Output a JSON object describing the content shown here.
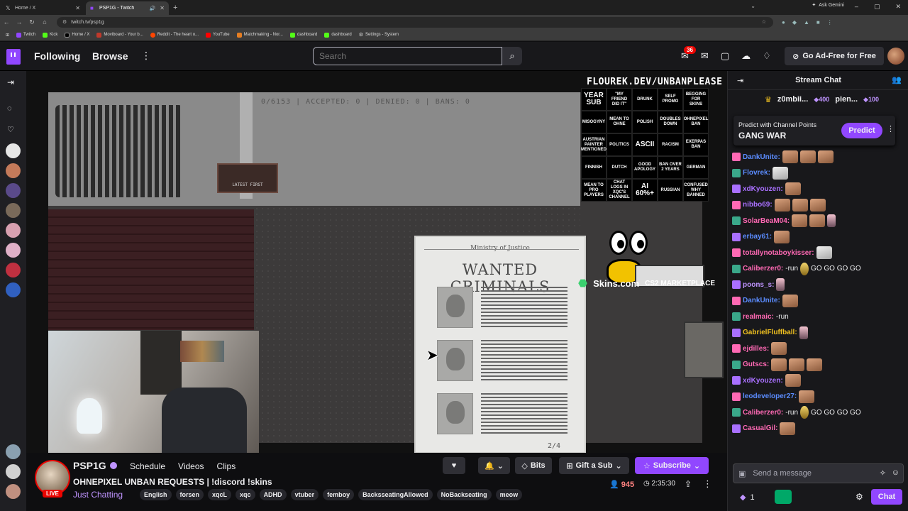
{
  "browser": {
    "tabs": [
      {
        "title": "Home / X",
        "active": false,
        "favicon": "x-icon"
      },
      {
        "title": "PSP1G - Twitch",
        "active": true,
        "favicon": "twitch-icon"
      }
    ],
    "url": "twitch.tv/psp1g",
    "ask_gemini": "Ask Gemini",
    "bookmarks": [
      "Twitch",
      "Kick",
      "Home / X",
      "Moviboard - Your b...",
      "Reddit - The heart o...",
      "YouTube",
      "Matchmaking - Nor...",
      "dashboard",
      "dashboard",
      "Settings - System"
    ]
  },
  "nav": {
    "following": "Following",
    "browse": "Browse",
    "search_placeholder": "Search",
    "notifications_count": "36",
    "ad_free": "Go Ad-Free for Free"
  },
  "stream": {
    "counter": "0/6153 | ACCEPTED: 0 | DENIED: 0 | BANS: 0",
    "latest_first": "LATEST FIRST",
    "doc_ministry": "Ministry of Justice",
    "doc_title": "WANTED CRIMINALS",
    "doc_page": "2/4",
    "overlay_url": "FLOUREK.DEV/UNBANPLEASE",
    "bingo": [
      "YEAR SUB",
      "\"MY FRIEND DID IT\"",
      "DRUNK",
      "SELF PROMO",
      "BEGGING FOR SKINS",
      "MISOGYNY",
      "MEAN TO OHNE",
      "POLISH",
      "DOUBLES DOWN",
      "OHNEPIXEL BAN",
      "AUSTRIAN PAINTER MENTIONED",
      "POLITICS",
      "ASCII",
      "RACISM",
      "EXERPAS BAN",
      "FINNISH",
      "DUTCH",
      "GOOD APOLOGY",
      "BAN OVER 2 YEARS",
      "GERMAN",
      "MEAN TO PRO PLAYERS",
      "CHAT LOGS IN XQC'S CHANNEL",
      "AI 60%+",
      "RUSSIAN",
      "CONFUSED WHY BANNED"
    ],
    "skins_brand": "Skins.com",
    "skins_tagline": "CS2 MARKETPLACE"
  },
  "channel": {
    "name": "PSP1G",
    "tabs": [
      "Schedule",
      "Videos",
      "Clips"
    ],
    "title": "OHNEPIXEL UNBAN REQUESTS | !discord !skins",
    "category": "Just Chatting",
    "tags": [
      "English",
      "forsen",
      "xqcL",
      "xqc",
      "ADHD",
      "vtuber",
      "femboy",
      "BacksseatingAllowed",
      "NoBackseating",
      "meow"
    ],
    "live": "LIVE",
    "bits": "Bits",
    "gift_sub": "Gift a Sub",
    "subscribe": "Subscribe",
    "viewers": "945",
    "uptime": "2:35:30"
  },
  "chat": {
    "title": "Stream Chat",
    "pinned": [
      {
        "user": "z0mbii...",
        "points": "400"
      },
      {
        "user": "pien...",
        "points": "100"
      }
    ],
    "prediction": {
      "label": "Predict with Channel Points",
      "title": "GANG WAR",
      "button": "Predict"
    },
    "messages": [
      {
        "user": "DankUnite:",
        "color": "#5b8cff",
        "text": "",
        "emotes": [
          "e",
          "e",
          "e"
        ]
      },
      {
        "user": "Flovrek:",
        "color": "#5b8cff",
        "text": "",
        "emotes": [
          "c"
        ]
      },
      {
        "user": "xdKyouzen:",
        "color": "#a970ff",
        "text": "",
        "emotes": [
          "e"
        ]
      },
      {
        "user": "nibbo69:",
        "color": "#a970ff",
        "text": "",
        "emotes": [
          "e",
          "e",
          "e"
        ]
      },
      {
        "user": "SolarBeaM04:",
        "color": "#ff69b4",
        "text": "",
        "emotes": [
          "e",
          "e",
          "g"
        ]
      },
      {
        "user": "erbay61:",
        "color": "#5b8cff",
        "text": "",
        "emotes": [
          "e"
        ]
      },
      {
        "user": "totallynotaboykisser:",
        "color": "#ff69b4",
        "text": "",
        "emotes": [
          "c"
        ]
      },
      {
        "user": "Caliberzer0:",
        "color": "#ff69b4",
        "text": " -run",
        "emotes": [
          "b"
        ],
        "after": "GO GO GO GO"
      },
      {
        "user": "poons_s:",
        "color": "#bf94ff",
        "text": "",
        "emotes": [
          "g"
        ]
      },
      {
        "user": "DankUnite:",
        "color": "#5b8cff",
        "text": "",
        "emotes": [
          "e"
        ]
      },
      {
        "user": "realmaic:",
        "color": "#ff69b4",
        "text": " -run",
        "emotes": []
      },
      {
        "user": "GabrielFluffball:",
        "color": "#f0c020",
        "text": "",
        "emotes": [
          "g"
        ]
      },
      {
        "user": "ejdilles:",
        "color": "#ff69b4",
        "text": "",
        "emotes": [
          "e"
        ]
      },
      {
        "user": "Gutscs:",
        "color": "#ff69b4",
        "text": "",
        "emotes": [
          "e",
          "e",
          "e"
        ]
      },
      {
        "user": "xdKyouzen:",
        "color": "#a970ff",
        "text": "",
        "emotes": [
          "e"
        ]
      },
      {
        "user": "leodeveloper27:",
        "color": "#5b8cff",
        "text": "",
        "emotes": [
          "e"
        ]
      },
      {
        "user": "Caliberzer0:",
        "color": "#ff69b4",
        "text": " -run",
        "emotes": [
          "b"
        ],
        "after": "GO GO GO GO"
      },
      {
        "user": "CasualGil:",
        "color": "#ff69b4",
        "text": "",
        "emotes": [
          "e"
        ]
      }
    ],
    "input_placeholder": "Send a message",
    "points": "1",
    "chat_button": "Chat"
  }
}
